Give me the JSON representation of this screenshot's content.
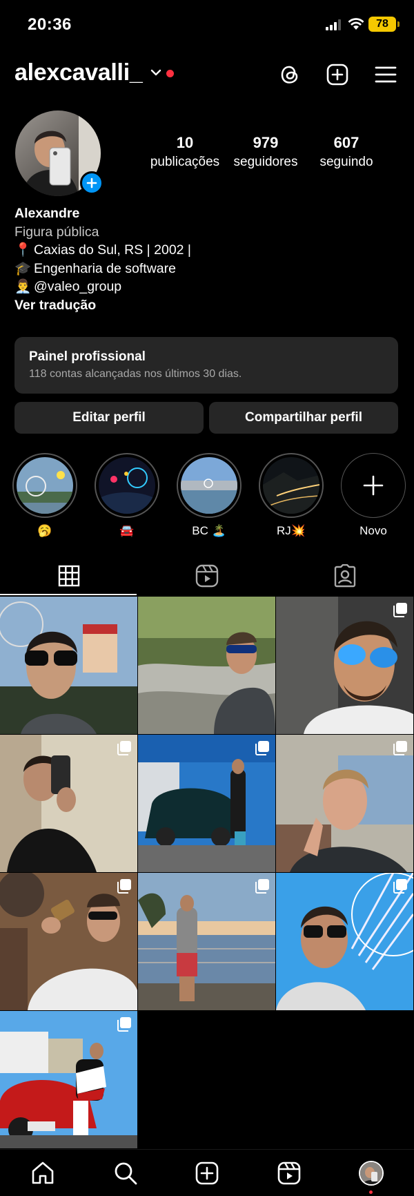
{
  "status_bar": {
    "time": "20:36",
    "battery": "78"
  },
  "header": {
    "username": "alexcavalli_",
    "icons": [
      "chevron-down-icon",
      "threads-icon",
      "create-icon",
      "menu-icon"
    ]
  },
  "stats": [
    {
      "value": "10",
      "label": "publicações"
    },
    {
      "value": "979",
      "label": "seguidores"
    },
    {
      "value": "607",
      "label": "seguindo"
    }
  ],
  "bio": {
    "name": "Alexandre",
    "category": "Figura pública",
    "lines": [
      {
        "emoji": "📍",
        "text": "Caxias do Sul, RS | 2002 |"
      },
      {
        "emoji": "🎓",
        "text": "Engenharia de software"
      },
      {
        "emoji": "👨‍💼",
        "text": "@valeo_group"
      }
    ],
    "translate": "Ver tradução"
  },
  "panel": {
    "title": "Painel profissional",
    "subtitle": "118 contas alcançadas nos últimos 30 dias."
  },
  "buttons": {
    "edit": "Editar perfil",
    "share": "Compartilhar perfil"
  },
  "highlights": [
    {
      "label": "🥱"
    },
    {
      "label": "🚘"
    },
    {
      "label": "BC 🏝️"
    },
    {
      "label": "RJ💥"
    },
    {
      "label": "Novo"
    }
  ],
  "tabs": [
    "grid-icon",
    "reels-icon",
    "tagged-icon"
  ],
  "posts_count": 10,
  "bottom_nav": [
    "home-icon",
    "search-icon",
    "create-icon",
    "reels-icon",
    "profile-avatar"
  ],
  "colors": {
    "accent": "#0095f6",
    "notification": "#ff3040",
    "surface": "#262626",
    "battery": "#f5c800"
  }
}
